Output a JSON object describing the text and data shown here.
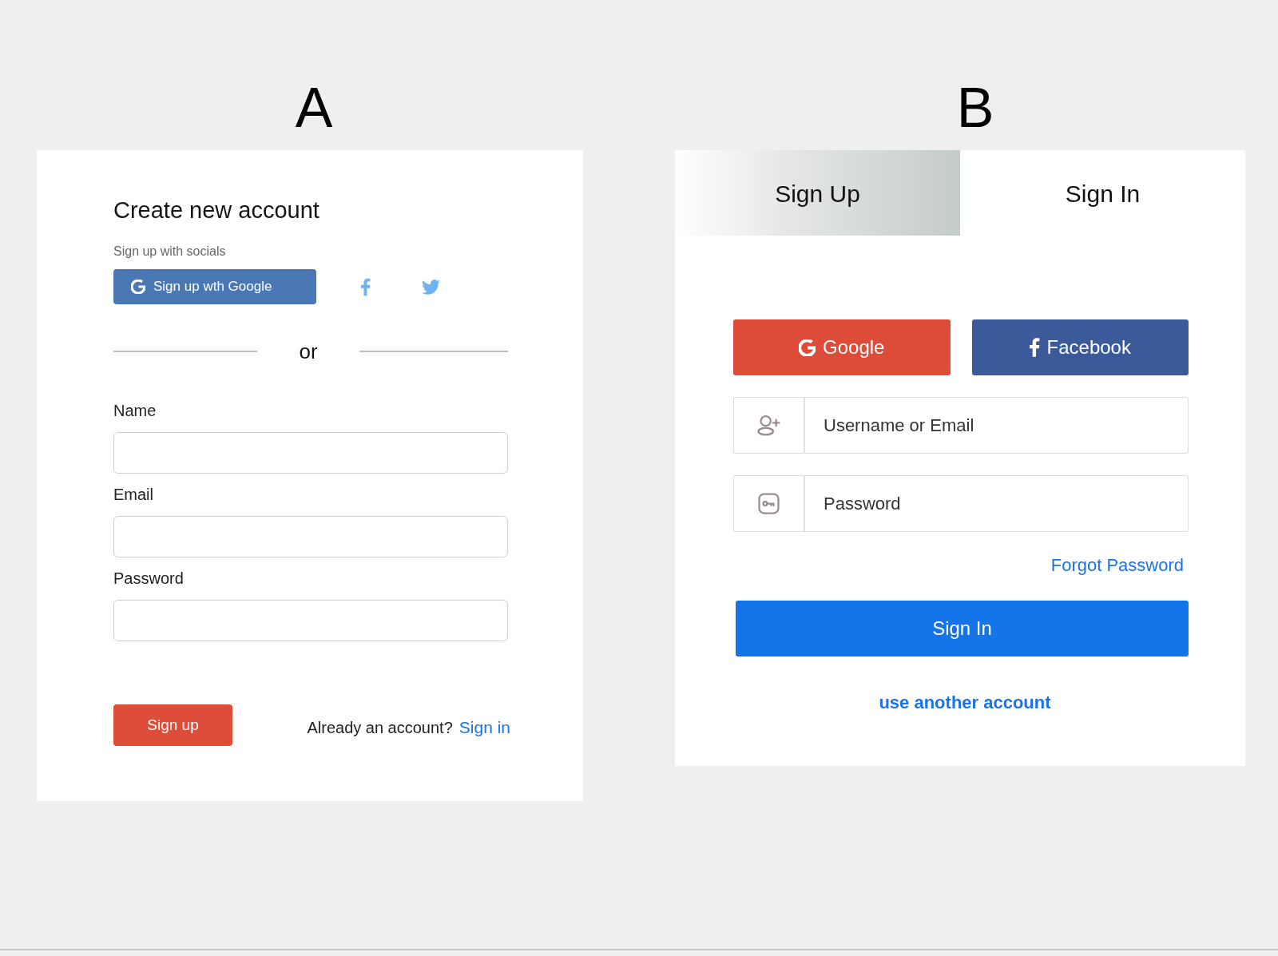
{
  "panel_a": {
    "heading": "A",
    "title": "Create new account",
    "socials_label": "Sign up with socials",
    "google_button": "Sign up wth Google",
    "separator": "or",
    "fields": [
      {
        "label": "Name"
      },
      {
        "label": "Email"
      },
      {
        "label": "Password"
      }
    ],
    "submit_button": "Sign up",
    "account_prompt": "Already an account?",
    "sign_in_link": "Sign in"
  },
  "panel_b": {
    "heading": "B",
    "tabs": [
      {
        "label": "Sign Up",
        "selected": true
      },
      {
        "label": "Sign In",
        "selected": false
      }
    ],
    "social_buttons": [
      {
        "kind": "google",
        "label": "Google"
      },
      {
        "kind": "facebook",
        "label": "Facebook"
      }
    ],
    "fields": [
      {
        "kind": "user",
        "placeholder": "Username or Email"
      },
      {
        "kind": "password",
        "placeholder": "Password"
      }
    ],
    "forgot_link": "Forgot Password",
    "submit_button": "Sign In",
    "alt_link": "use another account"
  }
}
